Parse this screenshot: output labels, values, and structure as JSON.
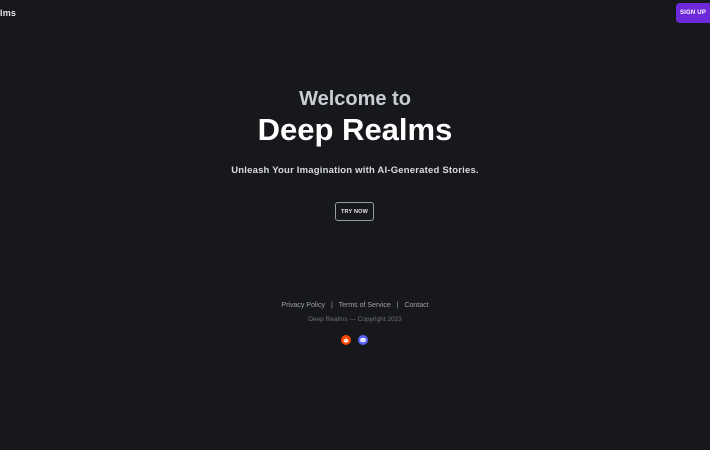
{
  "header": {
    "brand": "lms",
    "signup_label": "SIGN UP"
  },
  "hero": {
    "welcome": "Welcome to",
    "title": "Deep Realms",
    "tagline": "Unleash Your Imagination with AI-Generated Stories.",
    "cta_label": "TRY NOW"
  },
  "footer": {
    "links": [
      "Privacy Policy",
      "Terms of Service",
      "Contact"
    ],
    "separator": "|",
    "copyright": "Deep Realms — Copyright 2023",
    "socials": [
      {
        "icon": "reddit-icon",
        "color": "#ff4500"
      },
      {
        "icon": "discord-icon",
        "color": "#5865f2"
      }
    ]
  },
  "colors": {
    "background": "#17181c",
    "accent": "#6d28d9"
  }
}
